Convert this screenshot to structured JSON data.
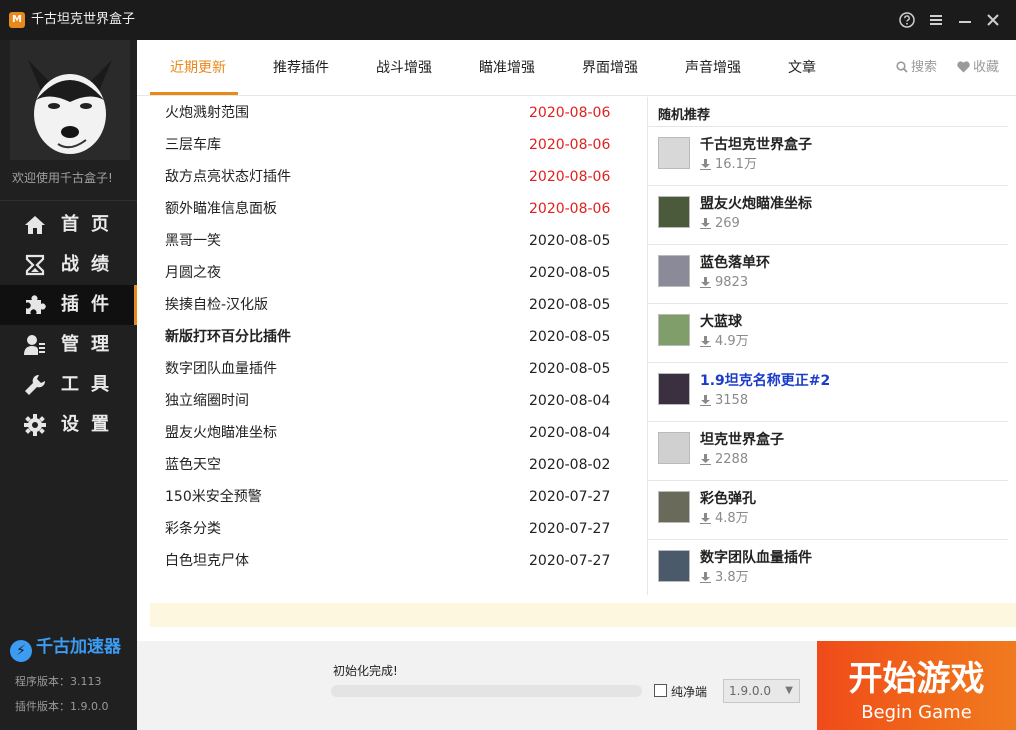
{
  "window": {
    "title": "千古坦克世界盒子",
    "logo_text": "M"
  },
  "sidebar": {
    "welcome": "欢迎使用千古盒子!",
    "items": [
      {
        "label": "首页",
        "icon": "home-icon",
        "active": false
      },
      {
        "label": "战绩",
        "icon": "hourglass-icon",
        "active": false
      },
      {
        "label": "插件",
        "icon": "puzzle-icon",
        "active": true
      },
      {
        "label": "管理",
        "icon": "user-manage-icon",
        "active": false
      },
      {
        "label": "工具",
        "icon": "wrench-icon",
        "active": false
      },
      {
        "label": "设置",
        "icon": "gear-icon",
        "active": false
      }
    ],
    "accelerator": "千古加速器",
    "program_version": "程序版本：3.113",
    "plugin_version": "插件版本：1.9.0.0"
  },
  "tabs": {
    "items": [
      "近期更新",
      "推荐插件",
      "战斗增强",
      "瞄准增强",
      "界面增强",
      "声音增强",
      "文章"
    ],
    "search": "搜索",
    "favorites": "收藏"
  },
  "plugins": [
    {
      "name": "火炮溅射范围",
      "date": "2020-08-06",
      "is_new": true,
      "bold": false
    },
    {
      "name": "三层车库",
      "date": "2020-08-06",
      "is_new": true,
      "bold": false
    },
    {
      "name": "敌方点亮状态灯插件",
      "date": "2020-08-06",
      "is_new": true,
      "bold": false
    },
    {
      "name": "额外瞄准信息面板",
      "date": "2020-08-06",
      "is_new": true,
      "bold": false
    },
    {
      "name": "黑哥一笑",
      "date": "2020-08-05",
      "is_new": false,
      "bold": false
    },
    {
      "name": "月圆之夜",
      "date": "2020-08-05",
      "is_new": false,
      "bold": false
    },
    {
      "name": "挨揍自检-汉化版",
      "date": "2020-08-05",
      "is_new": false,
      "bold": false
    },
    {
      "name": "新版打环百分比插件",
      "date": "2020-08-05",
      "is_new": false,
      "bold": true
    },
    {
      "name": "数字团队血量插件",
      "date": "2020-08-05",
      "is_new": false,
      "bold": false
    },
    {
      "name": "独立缩圈时间",
      "date": "2020-08-04",
      "is_new": false,
      "bold": false
    },
    {
      "name": "盟友火炮瞄准坐标",
      "date": "2020-08-04",
      "is_new": false,
      "bold": false
    },
    {
      "name": "蓝色天空",
      "date": "2020-08-02",
      "is_new": false,
      "bold": false
    },
    {
      "name": "150米安全预警",
      "date": "2020-07-27",
      "is_new": false,
      "bold": false
    },
    {
      "name": "彩条分类",
      "date": "2020-07-27",
      "is_new": false,
      "bold": false
    },
    {
      "name": "白色坦克尸体",
      "date": "2020-07-27",
      "is_new": false,
      "bold": false
    }
  ],
  "recommend": {
    "title": "随机推荐",
    "items": [
      {
        "name": "千古坦克世界盒子",
        "downloads": "16.1万",
        "link": false,
        "thumb": "#d8d8d8"
      },
      {
        "name": "盟友火炮瞄准坐标",
        "downloads": "269",
        "link": false,
        "thumb": "#4a5a3a"
      },
      {
        "name": "蓝色落单环",
        "downloads": "9823",
        "link": false,
        "thumb": "#8a8a98"
      },
      {
        "name": "大蓝球",
        "downloads": "4.9万",
        "link": false,
        "thumb": "#7f9e6a"
      },
      {
        "name": "1.9坦克名称更正#2",
        "downloads": "3158",
        "link": true,
        "thumb": "#3a3040"
      },
      {
        "name": "坦克世界盒子",
        "downloads": "2288",
        "link": false,
        "thumb": "#d0d0d0"
      },
      {
        "name": "彩色弹孔",
        "downloads": "4.8万",
        "link": false,
        "thumb": "#6a6a5a"
      },
      {
        "name": "数字团队血量插件",
        "downloads": "3.8万",
        "link": false,
        "thumb": "#4a5a6a"
      }
    ]
  },
  "footer": {
    "status": "初始化完成!",
    "progress": 0,
    "clean_label": "纯净端",
    "clean_checked": false,
    "version": "1.9.0.0",
    "start_cn": "开始游戏",
    "start_en": "Begin Game"
  },
  "colors": {
    "accent": "#e8891b",
    "new_date": "#e02020",
    "link": "#1a3cc8",
    "start": "#f0561a"
  }
}
